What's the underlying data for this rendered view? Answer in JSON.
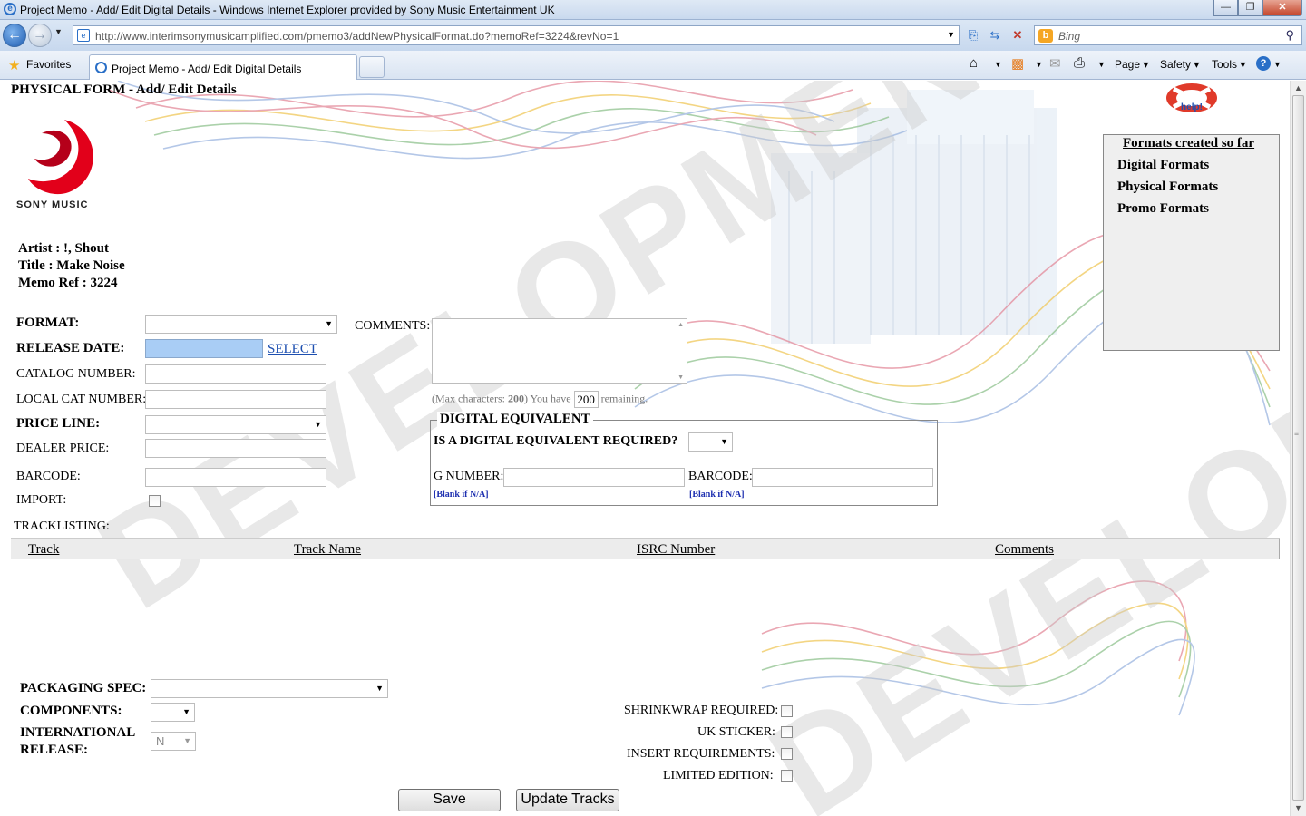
{
  "window": {
    "title": "Project Memo - Add/ Edit Digital Details - Windows Internet Explorer provided by Sony Music Entertainment UK"
  },
  "addressbar": {
    "url": "http://www.interimsonymusicamplified.com/pmemo3/addNewPhysicalFormat.do?memoRef=3224&revNo=1",
    "search_placeholder": "Bing"
  },
  "favbar": {
    "favorites_label": "Favorites",
    "tab_title": "Project Memo - Add/ Edit Digital Details",
    "commands": {
      "page": "Page",
      "safety": "Safety",
      "tools": "Tools"
    }
  },
  "page": {
    "form_title": "PHYSICAL FORM - Add/ Edit Details",
    "logo_text": "SONY MUSIC",
    "help_label": "help!",
    "watermark": "DEVELOPMENT",
    "info": {
      "artist": "Artist : !, Shout",
      "title": "Title : Make Noise",
      "memo_ref": "Memo Ref : 3224"
    },
    "formats_box": {
      "header": "Formats created so far",
      "items": [
        "Digital Formats",
        "Physical Formats",
        "Promo Formats"
      ]
    },
    "labels": {
      "format": "FORMAT:",
      "release_date": "RELEASE DATE:",
      "select_link": "SELECT",
      "catalog_number": "CATALOG NUMBER:",
      "local_cat_number": "LOCAL CAT NUMBER:",
      "price_line": "PRICE LINE:",
      "dealer_price": "DEALER PRICE:",
      "barcode": "BARCODE:",
      "import": "IMPORT:",
      "tracklisting": "TRACKLISTING:",
      "comments": "COMMENTS:",
      "max_chars_pre": "(Max characters: ",
      "max_chars_num": "200",
      "max_chars_mid": ") You have",
      "remaining_count": "200",
      "remaining": "remaining."
    },
    "digital_equivalent": {
      "legend": "DIGITAL EQUIVALENT",
      "question": "IS A DIGITAL EQUIVALENT REQUIRED?",
      "g_number": "G NUMBER:",
      "barcode": "BARCODE:",
      "hint_g": "[Blank if N/A]",
      "hint_barcode": "[Blank if N/A]"
    },
    "track_columns": [
      "Track",
      "Track Name",
      "ISRC Number",
      "Comments"
    ],
    "bottom": {
      "packaging_spec": "PACKAGING SPEC:",
      "components": "COMPONENTS:",
      "international_release_1": "INTERNATIONAL",
      "international_release_2": "RELEASE:",
      "international_value": "N",
      "shrinkwrap": "SHRINKWRAP REQUIRED:",
      "uk_sticker": "UK STICKER:",
      "insert_requirements": "INSERT REQUIREMENTS:",
      "limited_edition": "LIMITED EDITION:"
    },
    "buttons": {
      "save": "Save",
      "update_tracks": "Update Tracks"
    }
  }
}
